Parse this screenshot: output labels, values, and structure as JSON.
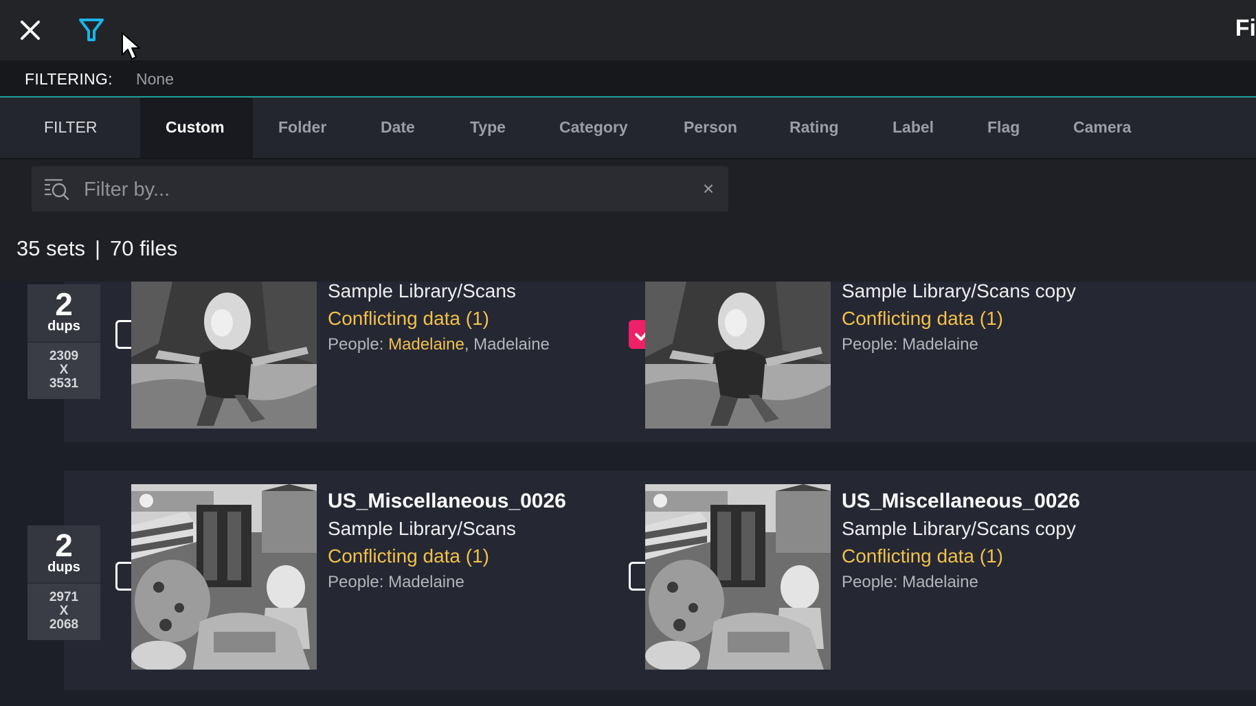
{
  "header": {
    "close_icon": "close-icon",
    "filter_icon": "funnel-icon",
    "right_title": "Fi"
  },
  "filtering": {
    "label": "FILTERING:",
    "value": "None"
  },
  "tabs": {
    "section_label": "FILTER",
    "items": [
      "Custom",
      "Folder",
      "Date",
      "Type",
      "Category",
      "Person",
      "Rating",
      "Label",
      "Flag",
      "Camera"
    ],
    "active": "Custom"
  },
  "search": {
    "placeholder": "Filter by...",
    "value": "",
    "clear_icon": "×"
  },
  "summary": {
    "sets": "35 sets",
    "separator": "|",
    "files": "70 files"
  },
  "groups": [
    {
      "dups_count": "2",
      "dups_word": "dups",
      "dims_w": "2309",
      "dims_x": "X",
      "dims_h": "3531",
      "files": [
        {
          "path": "Sample Library/Scans",
          "conflict": "Conflicting data (1)",
          "people_prefix": "People: ",
          "people_highlight": "Madelaine",
          "people_rest": ", Madelaine",
          "checked": false
        },
        {
          "path": "Sample Library/Scans copy",
          "conflict": "Conflicting data (1)",
          "people_prefix": "People: ",
          "people_highlight": "",
          "people_rest": "Madelaine",
          "checked": true
        }
      ]
    },
    {
      "dups_count": "2",
      "dups_word": "dups",
      "dims_w": "2971",
      "dims_x": "X",
      "dims_h": "2068",
      "files": [
        {
          "name": "US_Miscellaneous_0026",
          "path": "Sample Library/Scans",
          "conflict": "Conflicting data (1)",
          "people_prefix": "People: ",
          "people_rest": "Madelaine",
          "checked": false
        },
        {
          "name": "US_Miscellaneous_0026",
          "path": "Sample Library/Scans copy",
          "conflict": "Conflicting data (1)",
          "people_prefix": "People: ",
          "people_rest": "Madelaine",
          "checked": false
        }
      ]
    }
  ],
  "colors": {
    "accent_teal": "#1aa39a",
    "filter_icon": "#1ab5e8",
    "conflict": "#f3c04b",
    "checked": "#ef1f68"
  }
}
